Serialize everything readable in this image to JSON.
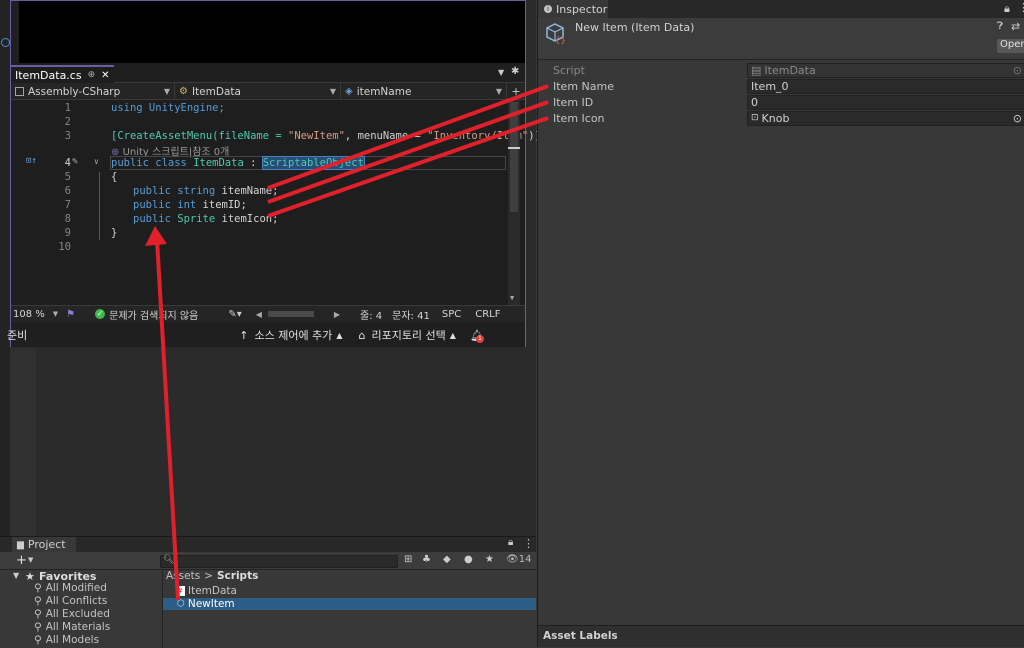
{
  "vs": {
    "tab_title": "ItemData.cs",
    "tab_pin": "⊕",
    "tab_close": "✕",
    "nav": {
      "project": "Assembly-CSharp",
      "class": "ItemData",
      "member": "itemName"
    },
    "code": {
      "line1": "using UnityEngine;",
      "line3_attr_a": "[CreateAssetMenu(fileName = ",
      "line3_str1": "\"NewItem\"",
      "line3_attr_b": ", menuName = ",
      "line3_str2": "\"Inventory/Item\"",
      "line3_attr_c": ")]",
      "codelens": "Unity 스크립트|참조 0개",
      "line4_kw": "public class ",
      "line4_name": "ItemData",
      "line4_colon": " : ",
      "line4_base": "ScriptableObject",
      "line5": "{",
      "line6_kw": "public string ",
      "line6_name": "itemName;",
      "line7_kw": "public int ",
      "line7_name": "itemID;",
      "line8_kw": "public ",
      "line8_type": "Sprite",
      "line8_name": " itemIcon;",
      "line9": "}",
      "line_numbers": [
        "1",
        "2",
        "3",
        "4",
        "5",
        "6",
        "7",
        "8",
        "9",
        "10"
      ]
    },
    "status": {
      "zoom": "108 %",
      "issues": "문제가 검색되지 않음",
      "line": "줄: 4",
      "col": "문자: 41",
      "spc": "SPC",
      "eol": "CRLF"
    },
    "bottom": {
      "ready": "준비",
      "source_control": "소스 제어에 추가",
      "repo": "리포지토리 선택",
      "notif_count": "1"
    }
  },
  "inspector": {
    "tab_label": "Inspector",
    "object_title": "New Item (Item Data)",
    "open_button": "Open",
    "rows": [
      {
        "label": "Script",
        "value": "ItemData"
      },
      {
        "label": "Item Name",
        "value": "Item_0"
      },
      {
        "label": "Item ID",
        "value": "0"
      },
      {
        "label": "Item Icon",
        "value": "Knob"
      }
    ],
    "asset_labels": "Asset Labels"
  },
  "project": {
    "tab_label": "Project",
    "hidden_count": "14",
    "favorites_label": "Favorites",
    "favorites": [
      "All Modified",
      "All Conflicts",
      "All Excluded",
      "All Materials",
      "All Models"
    ],
    "breadcrumb_root": "Assets",
    "breadcrumb_sep": ">",
    "breadcrumb_folder": "Scripts",
    "files": [
      "ItemData",
      "NewItem"
    ]
  },
  "colors": {
    "arrow": "#e0202a",
    "accent_purple": "#6b5ca5",
    "selection_blue": "#2c5d87"
  }
}
